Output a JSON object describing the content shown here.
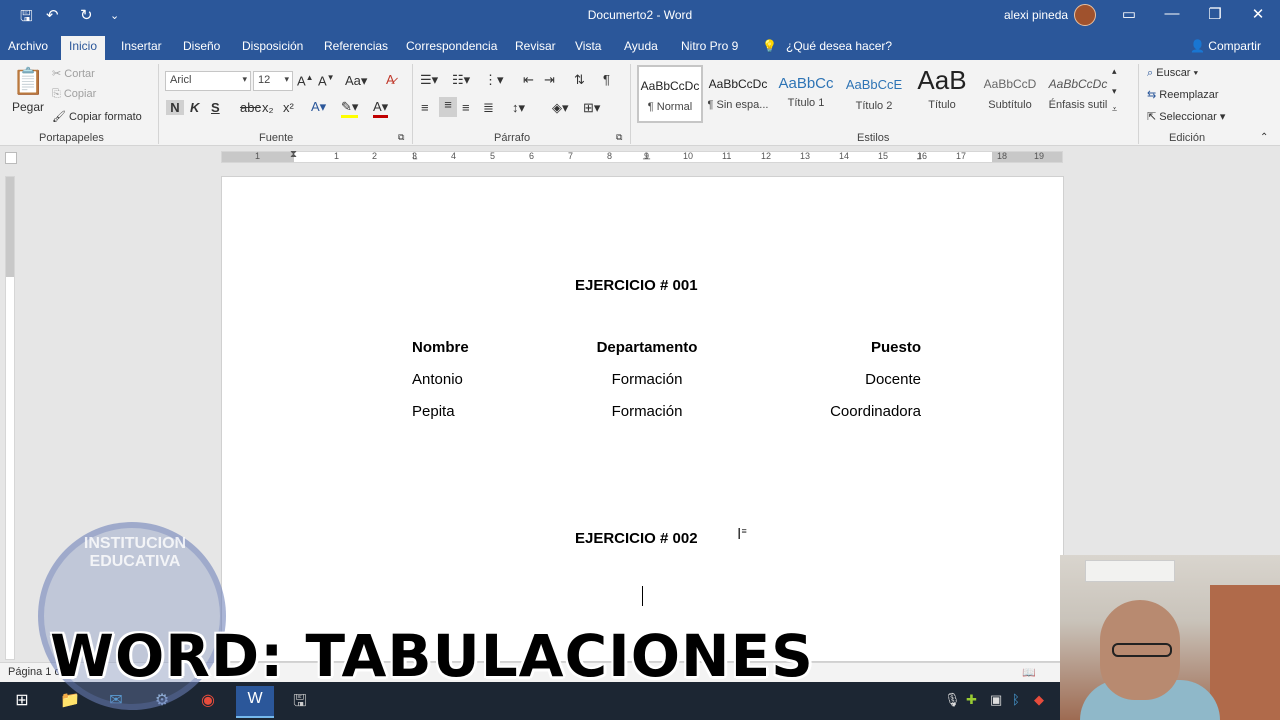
{
  "titlebar": {
    "title": "Documerto2  -  Word",
    "user": "alexi pineda"
  },
  "tabs": [
    "Archivo",
    "Inicio",
    "Insertar",
    "Diseño",
    "Disposición",
    "Referencias",
    "Correspondencia",
    "Revisar",
    "Vista",
    "Ayuda",
    "Nitro Pro 9",
    "¿Qué desea hacer?"
  ],
  "share_label": "Compartir",
  "clipboard": {
    "paste": "Pegar",
    "cut": "Cortar",
    "copy": "Copiar",
    "format_painter": "Copiar formato",
    "label": "Portapapeles"
  },
  "font": {
    "name": "Aricl",
    "size": "12",
    "label": "Fuente",
    "bold": "N",
    "italic": "K",
    "underline": "S"
  },
  "paragraph": {
    "label": "Párrafo"
  },
  "styles": {
    "label": "Estilos",
    "items": [
      {
        "preview": "AaBbCcDc",
        "name": "¶ Normal"
      },
      {
        "preview": "AaBbCcDc",
        "name": "¶ Sin espa..."
      },
      {
        "preview": "AaBbCc",
        "name": "Título 1"
      },
      {
        "preview": "AaBbCcE",
        "name": "Título 2"
      },
      {
        "preview": "AaB",
        "name": "Título"
      },
      {
        "preview": "AaBbCcD",
        "name": "Subtítulo"
      },
      {
        "preview": "AaBbCcDc",
        "name": "Énfasis sutil"
      }
    ]
  },
  "editing": {
    "find": "Euscar",
    "replace": "Reemplazar",
    "select": "Seleccionar",
    "label": "Edición"
  },
  "ruler_numbers": [
    "1",
    "1",
    "2",
    "3",
    "4",
    "5",
    "6",
    "7",
    "8",
    "9",
    "10",
    "11",
    "12",
    "13",
    "14",
    "15",
    "16",
    "17",
    "18",
    "19"
  ],
  "document": {
    "heading1": "EJERCICIO # 001",
    "headers": [
      "Nombre",
      "Departamento",
      "Puesto"
    ],
    "rows": [
      [
        "Antonio",
        "Formación",
        "Docente"
      ],
      [
        "Pepita",
        "Formación",
        "Coordinadora"
      ]
    ],
    "heading2": "EJERCICIO # 002"
  },
  "status": {
    "page": "Página 1 d"
  },
  "overlay": {
    "banner": "WORD: TABULACIONES",
    "watermark": "INSTITUCION EDUCATIVA"
  }
}
